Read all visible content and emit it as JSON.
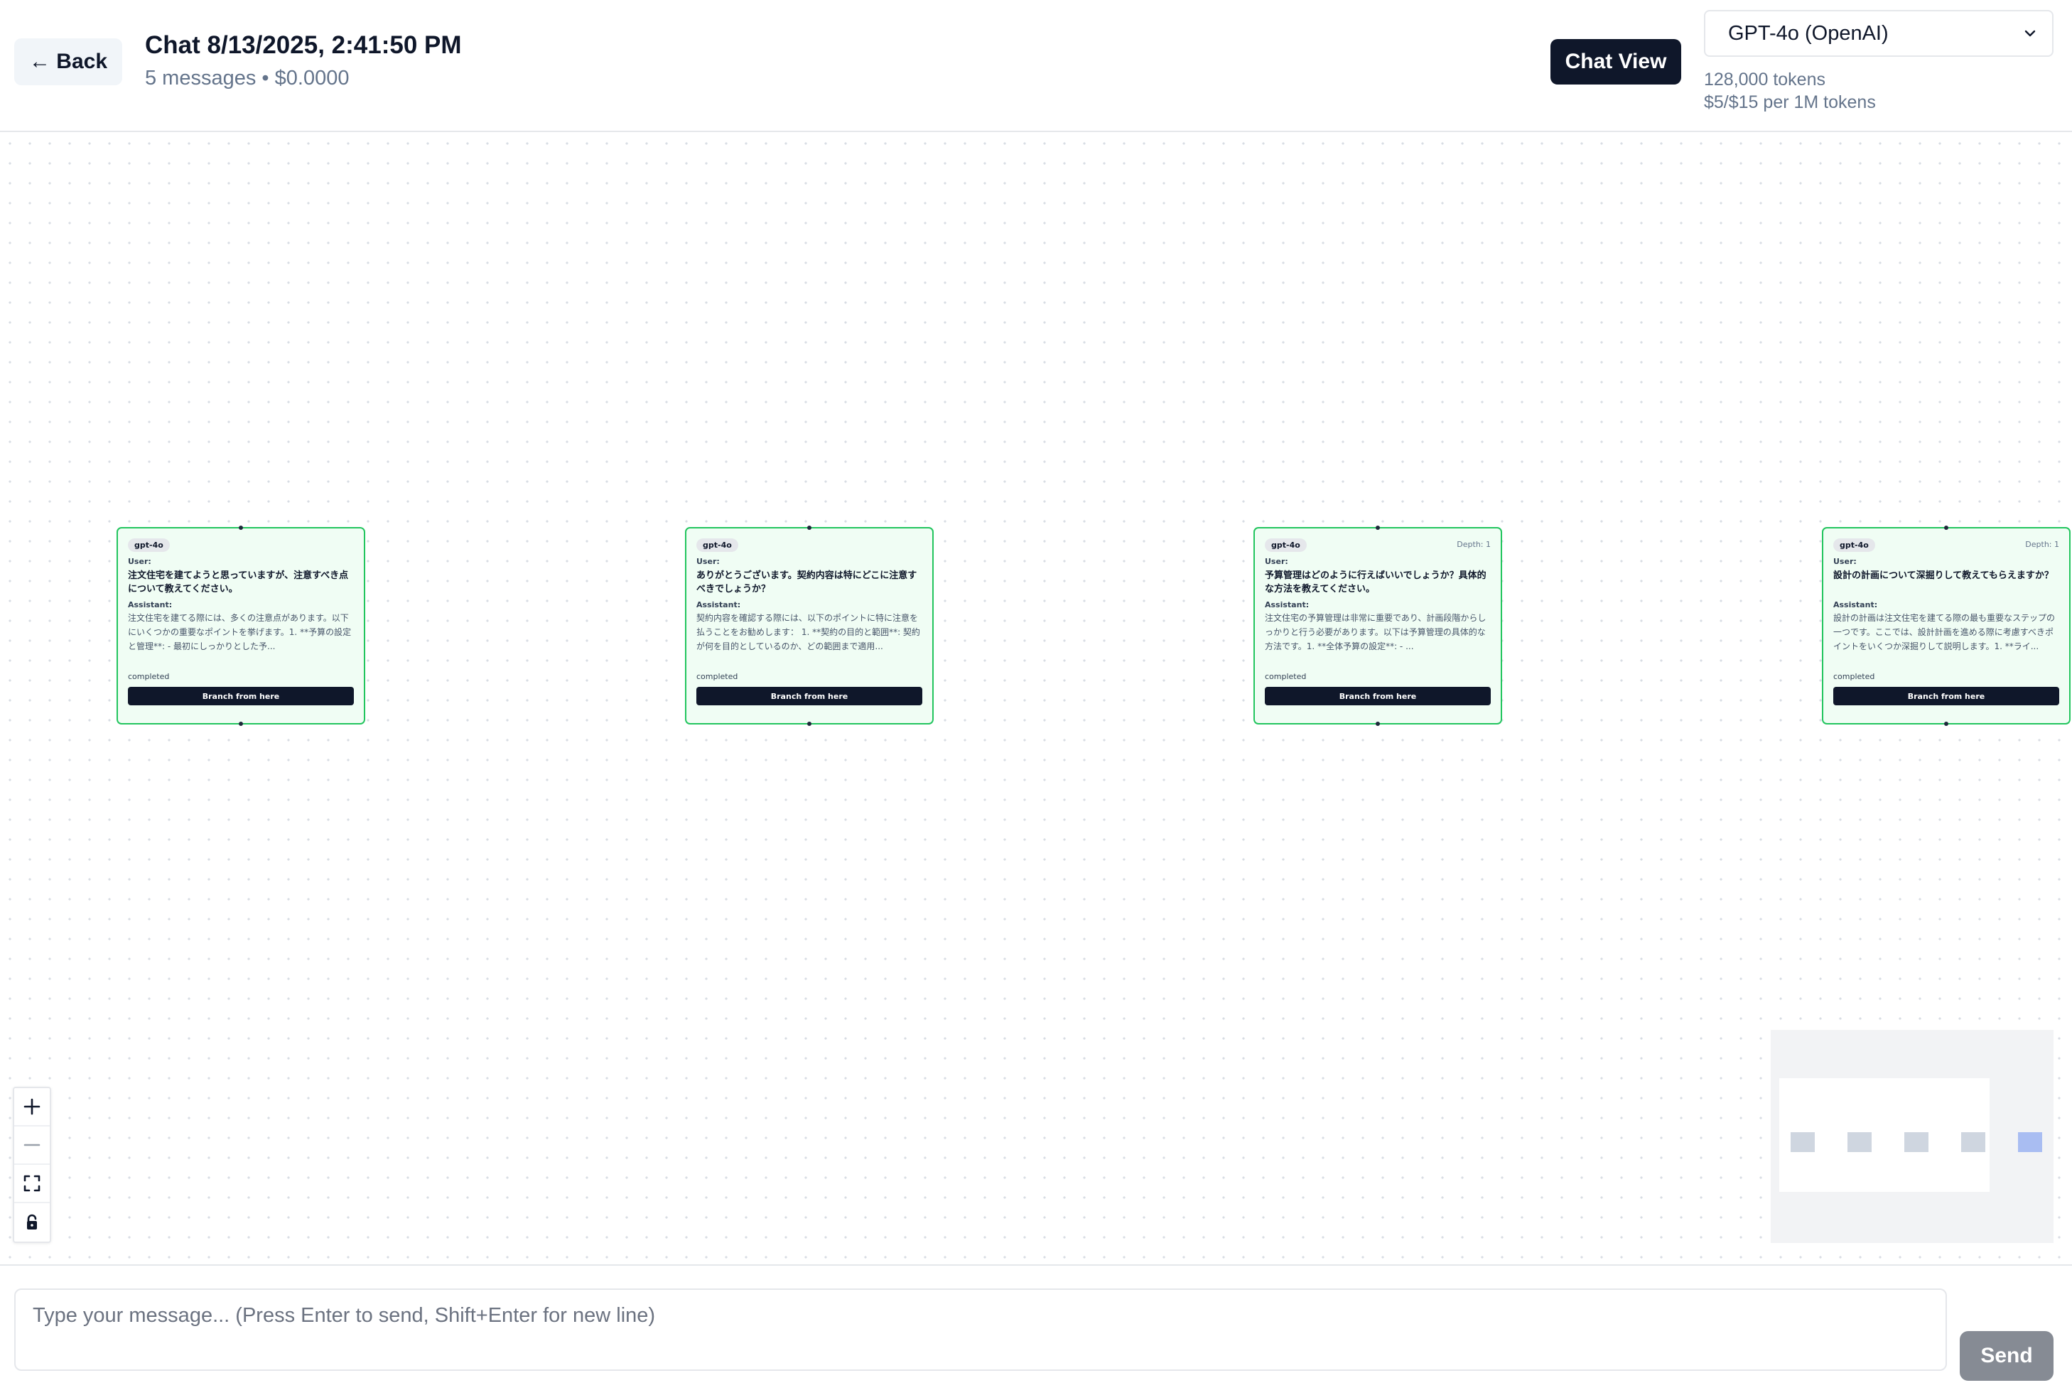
{
  "header": {
    "back_label": "← Back",
    "title": "Chat 8/13/2025, 2:41:50 PM",
    "subtitle": "5 messages • $0.0000",
    "chat_view_label": "Chat View",
    "model_select_value": "GPT-4o (OpenAI)",
    "context_tokens": "128,000 tokens",
    "pricing": "$5/$15 per 1M tokens"
  },
  "nodes": [
    {
      "model": "gpt-4o",
      "depth": "",
      "user_label": "User:",
      "user_text": "注文住宅を建てようと思っていますが、注意すべき点について教えてください。",
      "assistant_label": "Assistant:",
      "assistant_text": "注文住宅を建てる際には、多くの注意点があります。以下にいくつかの重要なポイントを挙げます。1. **予算の設定と管理**: - 最初にしっかりとした予...",
      "status": "completed",
      "branch_label": "Branch from here"
    },
    {
      "model": "gpt-4o",
      "depth": "",
      "user_label": "User:",
      "user_text": "ありがとうございます。契約内容は特にどこに注意すべきでしょうか？",
      "assistant_label": "Assistant:",
      "assistant_text": "契約内容を確認する際には、以下のポイントに特に注意を払うことをお勧めします： 1. **契約の目的と範囲**: 契約が何を目的としているのか、どの範囲まで適用...",
      "status": "completed",
      "branch_label": "Branch from here"
    },
    {
      "model": "gpt-4o",
      "depth": "Depth: 1",
      "user_label": "User:",
      "user_text": "予算管理はどのように行えばいいでしょうか？具体的な方法を教えてください。",
      "assistant_label": "Assistant:",
      "assistant_text": "注文住宅の予算管理は非常に重要であり、計画段階からしっかりと行う必要があります。以下は予算管理の具体的な方法です。1. **全体予算の設定**: - ...",
      "status": "completed",
      "branch_label": "Branch from here"
    },
    {
      "model": "gpt-4o",
      "depth": "Depth: 1",
      "user_label": "User:",
      "user_text": "設計の計画について深掘りして教えてもらえますか？",
      "assistant_label": "Assistant:",
      "assistant_text": "設計の計画は注文住宅を建てる際の最も重要なステップの一つです。ここでは、設計計画を進める際に考慮すべきポイントをいくつか深掘りして説明します。1. **ライ...",
      "status": "completed",
      "branch_label": "Branch from here"
    }
  ],
  "composer": {
    "placeholder": "Type your message... (Press Enter to send, Shift+Enter for new line)",
    "send_label": "Send"
  },
  "colors": {
    "node_border": "#22c55e",
    "node_bg": "#f0fdf4",
    "primary_dark": "#0f172a",
    "send_disabled": "#868b94",
    "minimap_active": "#a9bdf2"
  }
}
